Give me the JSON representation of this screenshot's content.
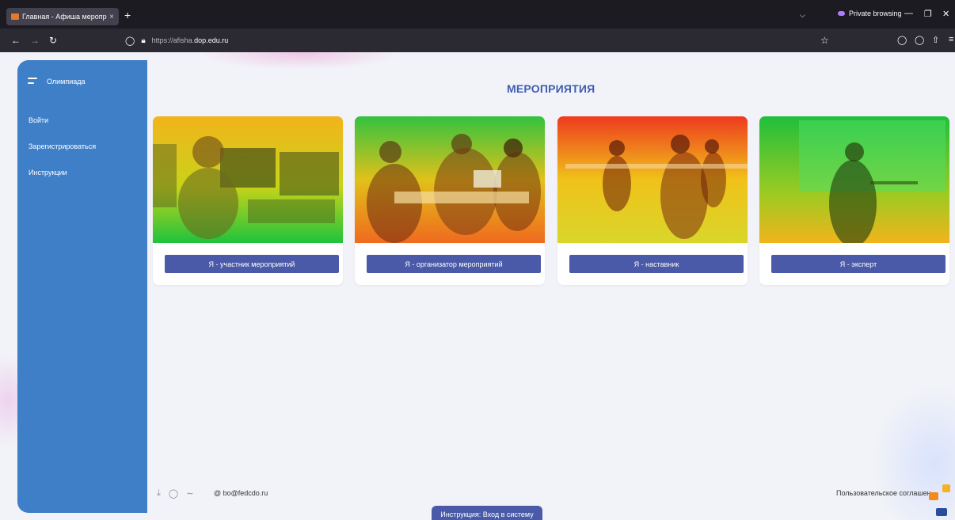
{
  "browser": {
    "tab_title": "Главная - Афиша мероприятий",
    "new_tab": "+",
    "close_tab": "×",
    "private_label": "Private browsing",
    "url_prefix": "https://afisha.",
    "url_host": "dop.edu.ru"
  },
  "sidebar": {
    "title": "Олимпиада",
    "items": [
      {
        "label": "Войти"
      },
      {
        "label": "Зарегистрироваться"
      },
      {
        "label": "Инструкции"
      }
    ]
  },
  "main": {
    "heading": "МЕРОПРИЯТИЯ",
    "cards": [
      {
        "button_label": "Я - участник мероприятий"
      },
      {
        "button_label": "Я - организатор мероприятий"
      },
      {
        "button_label": "Я - наставник"
      },
      {
        "button_label": "Я - эксперт"
      }
    ]
  },
  "footer": {
    "email": "@  bo@fedcdo.ru",
    "agreement": "Пользовательское соглашение",
    "instructions_button": "Инструкция: Вход в систему"
  },
  "colors": {
    "sidebar": "#3f7fc8",
    "accent": "#4a5aa8",
    "heading": "#3f5cb0",
    "page_bg": "#f2f3f8"
  }
}
